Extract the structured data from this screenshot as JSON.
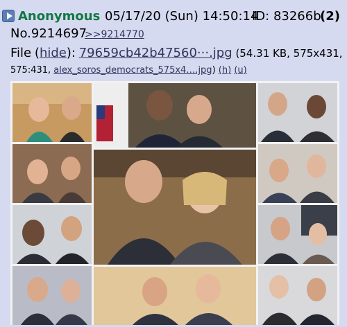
{
  "post": {
    "name": "Anonymous",
    "date": "05/17/20 (Sun) 14:50:14",
    "id_text": "ID: 83266b",
    "count": "(2)",
    "number": "No.9214697",
    "backlink": ">>9214770"
  },
  "file": {
    "label": "File",
    "hide_open": "(",
    "hide": "hide",
    "hide_close": "):",
    "filename": "79659cb42b47560···.jpg",
    "size": "(54.31 KB, 575x431,",
    "dims": "575:431,",
    "original_name": "alex_soros_democrats_575x4….jpg",
    "after_name": ")",
    "h_link": "(h)",
    "u_link": "(u)"
  },
  "icons": {
    "play": "play-icon"
  },
  "colors": {
    "background": "#d6daf0",
    "name": "#117743",
    "link": "#34345c"
  }
}
